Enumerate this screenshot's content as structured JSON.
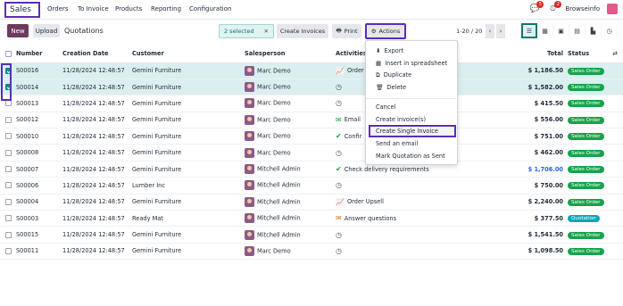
{
  "topbar": {
    "app_name": "Sales",
    "menu": [
      "Orders",
      "To Invoice",
      "Products",
      "Reporting",
      "Configuration"
    ],
    "chat_badge": "5",
    "activity_badge": "2",
    "company": "Browseinfo"
  },
  "controls": {
    "new_label": "New",
    "upload_label": "Upload",
    "title": "Quotations",
    "selected_label": "2 selected",
    "create_invoices_label": "Create Invoices",
    "print_label": "Print",
    "actions_label": "Actions",
    "pager": "1-20 / 20"
  },
  "table": {
    "headers": [
      "Number",
      "Creation Date",
      "Customer",
      "Salesperson",
      "Activities",
      "Total",
      "Status"
    ],
    "rows": [
      {
        "number": "S00016",
        "date": "11/28/2024 12:48:57",
        "customer": "Gemini Furniture",
        "salesperson": "Marc Demo",
        "activity": "Order",
        "activity_icon": "chart-icon",
        "total": "$ 1,186.50",
        "status": "Sales Order",
        "selected": true
      },
      {
        "number": "S00014",
        "date": "11/28/2024 12:48:57",
        "customer": "Gemini Furniture",
        "salesperson": "Marc Demo",
        "activity": "",
        "activity_icon": "clock-icon",
        "total": "$ 1,582.00",
        "status": "Sales Order",
        "selected": true
      },
      {
        "number": "S00013",
        "date": "11/28/2024 12:48:57",
        "customer": "Gemini Furniture",
        "salesperson": "Marc Demo",
        "activity": "",
        "activity_icon": "clock-icon",
        "total": "$ 415.50",
        "status": "Sales Order",
        "selected": false
      },
      {
        "number": "S00012",
        "date": "11/28/2024 12:48:57",
        "customer": "Gemini Furniture",
        "salesperson": "Marc Demo",
        "activity": "Email",
        "activity_icon": "email-icon",
        "total": "$ 556.00",
        "status": "Sales Order",
        "selected": false
      },
      {
        "number": "S00010",
        "date": "11/28/2024 12:48:57",
        "customer": "Gemini Furniture",
        "salesperson": "Marc Demo",
        "activity": "Confir",
        "activity_icon": "check-icon",
        "total": "$ 751.00",
        "status": "Sales Order",
        "selected": false
      },
      {
        "number": "S00008",
        "date": "11/28/2024 12:48:57",
        "customer": "Gemini Furniture",
        "salesperson": "Marc Demo",
        "activity": "",
        "activity_icon": "clock-icon",
        "total": "$ 462.00",
        "status": "Sales Order",
        "selected": false
      },
      {
        "number": "S00007",
        "date": "11/28/2024 12:48:57",
        "customer": "Gemini Furniture",
        "salesperson": "Mitchell Admin",
        "activity": "Check delivery requirements",
        "activity_icon": "check-icon",
        "total": "$ 1,706.00",
        "status": "Sales Order",
        "selected": false,
        "blue": true
      },
      {
        "number": "S00006",
        "date": "11/28/2024 12:48:57",
        "customer": "Lumber Inc",
        "salesperson": "Mitchell Admin",
        "activity": "",
        "activity_icon": "clock-icon",
        "total": "$ 750.00",
        "status": "Sales Order",
        "selected": false
      },
      {
        "number": "S00004",
        "date": "11/28/2024 12:48:57",
        "customer": "Gemini Furniture",
        "salesperson": "Mitchell Admin",
        "activity": "Order Upsell",
        "activity_icon": "chart-icon",
        "total": "$ 2,240.00",
        "status": "Sales Order",
        "selected": false
      },
      {
        "number": "S00003",
        "date": "11/28/2024 12:48:57",
        "customer": "Ready Mat",
        "salesperson": "Mitchell Admin",
        "activity": "Answer questions",
        "activity_icon": "email-icon",
        "total": "$ 377.50",
        "status": "Quotation",
        "selected": false
      },
      {
        "number": "S00015",
        "date": "11/28/2024 12:48:57",
        "customer": "Gemini Furniture",
        "salesperson": "Mitchell Admin",
        "activity": "",
        "activity_icon": "clock-icon",
        "total": "$ 1,541.50",
        "status": "Sales Order",
        "selected": false
      },
      {
        "number": "S00011",
        "date": "11/28/2024 12:48:57",
        "customer": "Gemini Furniture",
        "salesperson": "Marc Demo",
        "activity": "",
        "activity_icon": "clock-icon",
        "total": "$ 1,098.50",
        "status": "Sales Order",
        "selected": false
      }
    ]
  },
  "actions_menu": {
    "group1": [
      "Export",
      "Insert in spreadsheet",
      "Duplicate",
      "Delete"
    ],
    "group2": [
      "Cancel",
      "Create invoice(s)",
      "Create Single Invoice",
      "Send an email",
      "Mark Quotation as Sent"
    ]
  },
  "colors": {
    "brand": "#6e3a5f",
    "highlight": "#5b2dbd",
    "sales_order": "#16a34a",
    "quotation": "#0ea5b7"
  }
}
